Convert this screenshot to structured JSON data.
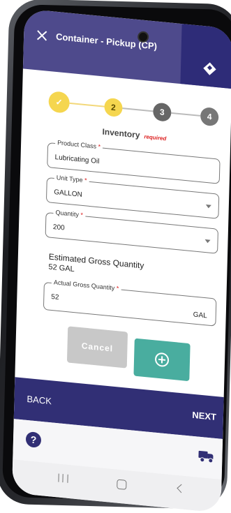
{
  "header": {
    "title": "Container - Pickup (CP)"
  },
  "stepper": {
    "steps": [
      "✓",
      "2",
      "3",
      "4"
    ]
  },
  "section": {
    "title": "Inventory",
    "required": "required"
  },
  "fields": {
    "product_class": {
      "label": "Product Class",
      "value": "Lubricating Oil"
    },
    "unit_type": {
      "label": "Unit Type",
      "value": "GALLON"
    },
    "quantity": {
      "label": "Quantity",
      "value": "200"
    },
    "actual_gross": {
      "label": "Actual Gross Quantity",
      "value": "52",
      "unit": "GAL"
    }
  },
  "estimated": {
    "label": "Estimated Gross Quantity",
    "value": "52 GAL"
  },
  "buttons": {
    "cancel": "Cancel"
  },
  "nav": {
    "back": "BACK",
    "next": "NEXT"
  },
  "bottom": {
    "help": "?"
  },
  "colors": {
    "primary": "#312f75",
    "accent": "#49ad9f",
    "step_active": "#f5d64f"
  }
}
